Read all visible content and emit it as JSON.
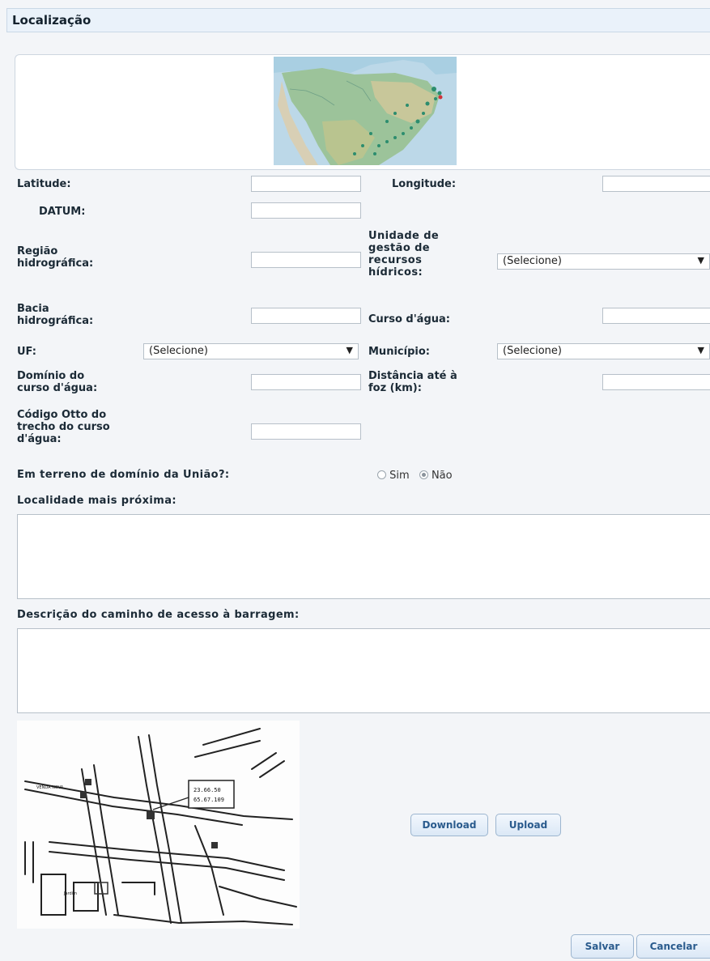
{
  "section_title": "Localização",
  "fields": {
    "latitude": {
      "label": "Latitude:",
      "value": ""
    },
    "longitude": {
      "label": "Longitude:",
      "value": ""
    },
    "datum": {
      "label": "DATUM:",
      "value": ""
    },
    "regiao": {
      "label_lines": [
        "Região",
        "hidrográfica:"
      ],
      "value": ""
    },
    "unidade": {
      "label_lines": [
        "Unidade de",
        "gestão de",
        "recursos",
        "hídricos:"
      ],
      "selected": "(Selecione)"
    },
    "bacia": {
      "label_lines": [
        "Bacia",
        "hidrográfica:"
      ],
      "value": ""
    },
    "curso": {
      "label": "Curso d'água:",
      "value": ""
    },
    "uf": {
      "label": "UF:",
      "selected": "(Selecione)"
    },
    "municipio": {
      "label": "Município:",
      "selected": "(Selecione)"
    },
    "dominio": {
      "label_lines": [
        "Domínio do",
        "curso d'água:"
      ],
      "value": ""
    },
    "distancia": {
      "label_lines": [
        "Distância até à",
        "foz (km):"
      ],
      "value": ""
    },
    "codigo_otto": {
      "label_lines": [
        "Código Otto do",
        "trecho do curso",
        "d'água:"
      ],
      "value": ""
    },
    "terreno_uniao": {
      "label": "Em terreno de domínio da União?:",
      "options": [
        "Sim",
        "Não"
      ],
      "selected": "Não"
    },
    "localidade": {
      "label": "Localidade mais próxima:",
      "value": ""
    },
    "descricao": {
      "label": "Descrição do caminho de acesso à barragem:",
      "value": ""
    }
  },
  "sketch_map": {
    "coords_box": [
      "23.66.50",
      "65.67.109"
    ],
    "labels": [
      "VENDA NOVA",
      "Jardim"
    ]
  },
  "buttons": {
    "download": "Download",
    "upload": "Upload",
    "save": "Salvar",
    "cancel": "Cancelar"
  },
  "icons": {
    "dropdown": "▼"
  },
  "colors": {
    "header_bg": "#eaf2fa",
    "button_text": "#2a5b8d",
    "page_bg": "#f3f5f8"
  }
}
